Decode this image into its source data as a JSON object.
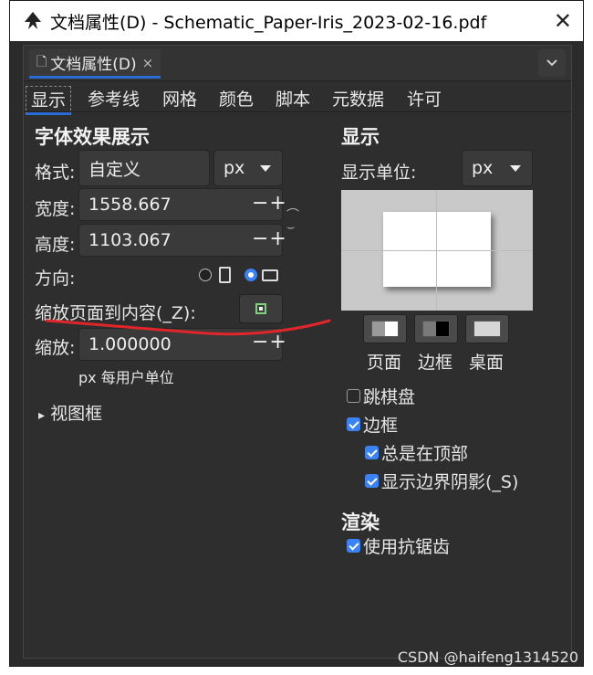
{
  "window": {
    "title": "文档属性(D) - Schematic_Paper-Iris_2023-02-16.pdf",
    "close_label": "✕"
  },
  "tab": {
    "label": "文档属性(D)",
    "close_label": "×",
    "menu_label": "⌄"
  },
  "subtabs": [
    "显示",
    "参考线",
    "网格",
    "颜色",
    "脚本",
    "元数据",
    "许可"
  ],
  "left": {
    "heading": "字体效果展示",
    "format_label": "格式:",
    "format_value": "自定义",
    "format_unit": "px",
    "width_label": "宽度:",
    "width_value": "1558.667",
    "height_label": "高度:",
    "height_value": "1103.067",
    "spin_label": "−+",
    "orientation_label": "方向:",
    "fit_label": "缩放页面到内容(_Z):",
    "scale_label": "缩放:",
    "scale_value": "1.000000",
    "scale_hint": "px 每用户单位",
    "viewbox_label": "视图框",
    "viewbox_arrow": "▸"
  },
  "right": {
    "heading": "显示",
    "unit_label": "显示单位:",
    "unit_value": "px",
    "color_page_label": "页面",
    "color_border_label": "边框",
    "color_desk_label": "桌面",
    "checkerboard_label": "跳棋盘",
    "border_label": "边框",
    "always_on_top_label": "总是在顶部",
    "show_shadow_label": "显示边界阴影(_S)",
    "render_heading": "渲染",
    "antialias_label": "使用抗锯齿"
  },
  "checks": {
    "checkerboard": false,
    "border": true,
    "always_on_top": true,
    "show_shadow": true,
    "antialias": true
  },
  "orientation": "landscape",
  "watermark": "CSDN @haifeng1314520",
  "colors": {
    "accent": "#3b82f6",
    "background": "#2e2e2e",
    "annotation_red": "#e0262a"
  }
}
